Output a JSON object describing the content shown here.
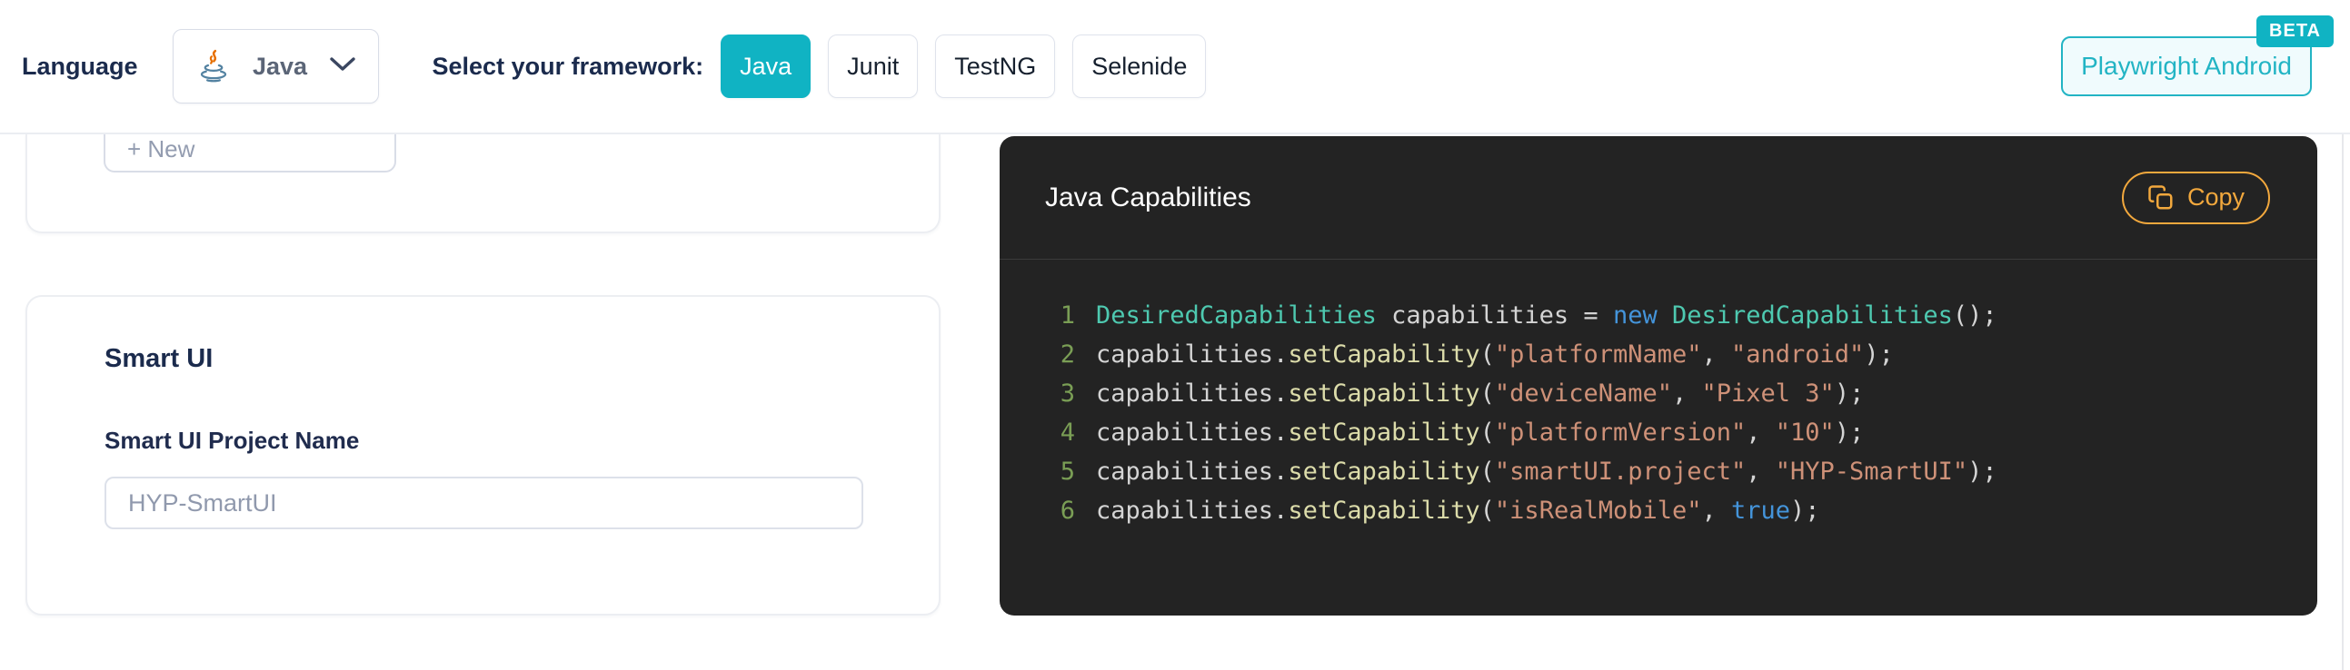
{
  "header": {
    "language_label": "Language",
    "language_dropdown": {
      "value": "Java",
      "icon": "java-logo-icon"
    },
    "framework_label": "Select your framework:",
    "frameworks": [
      {
        "label": "Java",
        "selected": true
      },
      {
        "label": "Junit",
        "selected": false
      },
      {
        "label": "TestNG",
        "selected": false
      },
      {
        "label": "Selenide",
        "selected": false
      }
    ],
    "playwright_button": {
      "label": "Playwright Android",
      "badge": "BETA"
    }
  },
  "left_panel": {
    "new_button_label": "+ New",
    "smartui_card": {
      "title": "Smart UI",
      "field_label": "Smart UI Project Name",
      "field_placeholder": "HYP-SmartUI",
      "field_value": ""
    }
  },
  "code_panel": {
    "title": "Java Capabilities",
    "copy_button_label": "Copy",
    "language": "java",
    "lines": [
      {
        "number": 1,
        "tokens": [
          {
            "t": "class",
            "v": "DesiredCapabilities"
          },
          {
            "t": "plain",
            "v": " capabilities = "
          },
          {
            "t": "keyword",
            "v": "new"
          },
          {
            "t": "plain",
            "v": " "
          },
          {
            "t": "class",
            "v": "DesiredCapabilities"
          },
          {
            "t": "plain",
            "v": "();"
          }
        ]
      },
      {
        "number": 2,
        "tokens": [
          {
            "t": "plain",
            "v": "capabilities."
          },
          {
            "t": "method",
            "v": "setCapability"
          },
          {
            "t": "plain",
            "v": "("
          },
          {
            "t": "string",
            "v": "\"platformName\""
          },
          {
            "t": "plain",
            "v": ", "
          },
          {
            "t": "string",
            "v": "\"android\""
          },
          {
            "t": "plain",
            "v": ");"
          }
        ]
      },
      {
        "number": 3,
        "tokens": [
          {
            "t": "plain",
            "v": "capabilities."
          },
          {
            "t": "method",
            "v": "setCapability"
          },
          {
            "t": "plain",
            "v": "("
          },
          {
            "t": "string",
            "v": "\"deviceName\""
          },
          {
            "t": "plain",
            "v": ", "
          },
          {
            "t": "string",
            "v": "\"Pixel 3\""
          },
          {
            "t": "plain",
            "v": ");"
          }
        ]
      },
      {
        "number": 4,
        "tokens": [
          {
            "t": "plain",
            "v": "capabilities."
          },
          {
            "t": "method",
            "v": "setCapability"
          },
          {
            "t": "plain",
            "v": "("
          },
          {
            "t": "string",
            "v": "\"platformVersion\""
          },
          {
            "t": "plain",
            "v": ", "
          },
          {
            "t": "string",
            "v": "\"10\""
          },
          {
            "t": "plain",
            "v": ");"
          }
        ]
      },
      {
        "number": 5,
        "tokens": [
          {
            "t": "plain",
            "v": "capabilities."
          },
          {
            "t": "method",
            "v": "setCapability"
          },
          {
            "t": "plain",
            "v": "("
          },
          {
            "t": "string",
            "v": "\"smartUI.project\""
          },
          {
            "t": "plain",
            "v": ", "
          },
          {
            "t": "string",
            "v": "\"HYP-SmartUI\""
          },
          {
            "t": "plain",
            "v": ");"
          }
        ]
      },
      {
        "number": 6,
        "tokens": [
          {
            "t": "plain",
            "v": "capabilities."
          },
          {
            "t": "method",
            "v": "setCapability"
          },
          {
            "t": "plain",
            "v": "("
          },
          {
            "t": "string",
            "v": "\"isRealMobile\""
          },
          {
            "t": "plain",
            "v": ", "
          },
          {
            "t": "keyword",
            "v": "true"
          },
          {
            "t": "plain",
            "v": ");"
          }
        ]
      }
    ]
  },
  "colors": {
    "accent_teal": "#10b3c3",
    "copy_gold": "#f2a83d",
    "navy_text": "#1b2b4d",
    "code_background": "#232323",
    "code_line_number": "#7a9e55",
    "code_plain": "#d4d4d4",
    "code_class": "#4ec9b0",
    "code_keyword": "#4494da",
    "code_method": "#dcdcaa",
    "code_string": "#ce9178"
  }
}
